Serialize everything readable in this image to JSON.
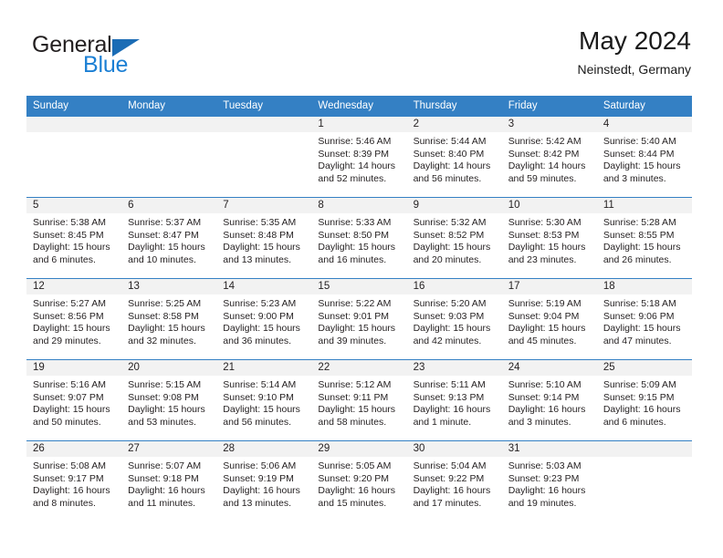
{
  "brand": {
    "line1": "General",
    "line2": "Blue",
    "triangle_color": "#1b6cb5",
    "blue_text_color": "#1b7fd4"
  },
  "header": {
    "title": "May 2024",
    "subtitle": "Neinstedt, Germany",
    "header_bg": "#3480c4",
    "daynum_bg": "#f2f2f2"
  },
  "weekdays": [
    "Sunday",
    "Monday",
    "Tuesday",
    "Wednesday",
    "Thursday",
    "Friday",
    "Saturday"
  ],
  "weeks": [
    [
      {
        "day": "",
        "empty": true
      },
      {
        "day": "",
        "empty": true
      },
      {
        "day": "",
        "empty": true
      },
      {
        "day": "1",
        "sunrise": "Sunrise: 5:46 AM",
        "sunset": "Sunset: 8:39 PM",
        "daylight1": "Daylight: 14 hours",
        "daylight2": "and 52 minutes."
      },
      {
        "day": "2",
        "sunrise": "Sunrise: 5:44 AM",
        "sunset": "Sunset: 8:40 PM",
        "daylight1": "Daylight: 14 hours",
        "daylight2": "and 56 minutes."
      },
      {
        "day": "3",
        "sunrise": "Sunrise: 5:42 AM",
        "sunset": "Sunset: 8:42 PM",
        "daylight1": "Daylight: 14 hours",
        "daylight2": "and 59 minutes."
      },
      {
        "day": "4",
        "sunrise": "Sunrise: 5:40 AM",
        "sunset": "Sunset: 8:44 PM",
        "daylight1": "Daylight: 15 hours",
        "daylight2": "and 3 minutes."
      }
    ],
    [
      {
        "day": "5",
        "sunrise": "Sunrise: 5:38 AM",
        "sunset": "Sunset: 8:45 PM",
        "daylight1": "Daylight: 15 hours",
        "daylight2": "and 6 minutes."
      },
      {
        "day": "6",
        "sunrise": "Sunrise: 5:37 AM",
        "sunset": "Sunset: 8:47 PM",
        "daylight1": "Daylight: 15 hours",
        "daylight2": "and 10 minutes."
      },
      {
        "day": "7",
        "sunrise": "Sunrise: 5:35 AM",
        "sunset": "Sunset: 8:48 PM",
        "daylight1": "Daylight: 15 hours",
        "daylight2": "and 13 minutes."
      },
      {
        "day": "8",
        "sunrise": "Sunrise: 5:33 AM",
        "sunset": "Sunset: 8:50 PM",
        "daylight1": "Daylight: 15 hours",
        "daylight2": "and 16 minutes."
      },
      {
        "day": "9",
        "sunrise": "Sunrise: 5:32 AM",
        "sunset": "Sunset: 8:52 PM",
        "daylight1": "Daylight: 15 hours",
        "daylight2": "and 20 minutes."
      },
      {
        "day": "10",
        "sunrise": "Sunrise: 5:30 AM",
        "sunset": "Sunset: 8:53 PM",
        "daylight1": "Daylight: 15 hours",
        "daylight2": "and 23 minutes."
      },
      {
        "day": "11",
        "sunrise": "Sunrise: 5:28 AM",
        "sunset": "Sunset: 8:55 PM",
        "daylight1": "Daylight: 15 hours",
        "daylight2": "and 26 minutes."
      }
    ],
    [
      {
        "day": "12",
        "sunrise": "Sunrise: 5:27 AM",
        "sunset": "Sunset: 8:56 PM",
        "daylight1": "Daylight: 15 hours",
        "daylight2": "and 29 minutes."
      },
      {
        "day": "13",
        "sunrise": "Sunrise: 5:25 AM",
        "sunset": "Sunset: 8:58 PM",
        "daylight1": "Daylight: 15 hours",
        "daylight2": "and 32 minutes."
      },
      {
        "day": "14",
        "sunrise": "Sunrise: 5:23 AM",
        "sunset": "Sunset: 9:00 PM",
        "daylight1": "Daylight: 15 hours",
        "daylight2": "and 36 minutes."
      },
      {
        "day": "15",
        "sunrise": "Sunrise: 5:22 AM",
        "sunset": "Sunset: 9:01 PM",
        "daylight1": "Daylight: 15 hours",
        "daylight2": "and 39 minutes."
      },
      {
        "day": "16",
        "sunrise": "Sunrise: 5:20 AM",
        "sunset": "Sunset: 9:03 PM",
        "daylight1": "Daylight: 15 hours",
        "daylight2": "and 42 minutes."
      },
      {
        "day": "17",
        "sunrise": "Sunrise: 5:19 AM",
        "sunset": "Sunset: 9:04 PM",
        "daylight1": "Daylight: 15 hours",
        "daylight2": "and 45 minutes."
      },
      {
        "day": "18",
        "sunrise": "Sunrise: 5:18 AM",
        "sunset": "Sunset: 9:06 PM",
        "daylight1": "Daylight: 15 hours",
        "daylight2": "and 47 minutes."
      }
    ],
    [
      {
        "day": "19",
        "sunrise": "Sunrise: 5:16 AM",
        "sunset": "Sunset: 9:07 PM",
        "daylight1": "Daylight: 15 hours",
        "daylight2": "and 50 minutes."
      },
      {
        "day": "20",
        "sunrise": "Sunrise: 5:15 AM",
        "sunset": "Sunset: 9:08 PM",
        "daylight1": "Daylight: 15 hours",
        "daylight2": "and 53 minutes."
      },
      {
        "day": "21",
        "sunrise": "Sunrise: 5:14 AM",
        "sunset": "Sunset: 9:10 PM",
        "daylight1": "Daylight: 15 hours",
        "daylight2": "and 56 minutes."
      },
      {
        "day": "22",
        "sunrise": "Sunrise: 5:12 AM",
        "sunset": "Sunset: 9:11 PM",
        "daylight1": "Daylight: 15 hours",
        "daylight2": "and 58 minutes."
      },
      {
        "day": "23",
        "sunrise": "Sunrise: 5:11 AM",
        "sunset": "Sunset: 9:13 PM",
        "daylight1": "Daylight: 16 hours",
        "daylight2": "and 1 minute."
      },
      {
        "day": "24",
        "sunrise": "Sunrise: 5:10 AM",
        "sunset": "Sunset: 9:14 PM",
        "daylight1": "Daylight: 16 hours",
        "daylight2": "and 3 minutes."
      },
      {
        "day": "25",
        "sunrise": "Sunrise: 5:09 AM",
        "sunset": "Sunset: 9:15 PM",
        "daylight1": "Daylight: 16 hours",
        "daylight2": "and 6 minutes."
      }
    ],
    [
      {
        "day": "26",
        "sunrise": "Sunrise: 5:08 AM",
        "sunset": "Sunset: 9:17 PM",
        "daylight1": "Daylight: 16 hours",
        "daylight2": "and 8 minutes."
      },
      {
        "day": "27",
        "sunrise": "Sunrise: 5:07 AM",
        "sunset": "Sunset: 9:18 PM",
        "daylight1": "Daylight: 16 hours",
        "daylight2": "and 11 minutes."
      },
      {
        "day": "28",
        "sunrise": "Sunrise: 5:06 AM",
        "sunset": "Sunset: 9:19 PM",
        "daylight1": "Daylight: 16 hours",
        "daylight2": "and 13 minutes."
      },
      {
        "day": "29",
        "sunrise": "Sunrise: 5:05 AM",
        "sunset": "Sunset: 9:20 PM",
        "daylight1": "Daylight: 16 hours",
        "daylight2": "and 15 minutes."
      },
      {
        "day": "30",
        "sunrise": "Sunrise: 5:04 AM",
        "sunset": "Sunset: 9:22 PM",
        "daylight1": "Daylight: 16 hours",
        "daylight2": "and 17 minutes."
      },
      {
        "day": "31",
        "sunrise": "Sunrise: 5:03 AM",
        "sunset": "Sunset: 9:23 PM",
        "daylight1": "Daylight: 16 hours",
        "daylight2": "and 19 minutes."
      },
      {
        "day": "",
        "empty": true
      }
    ]
  ]
}
